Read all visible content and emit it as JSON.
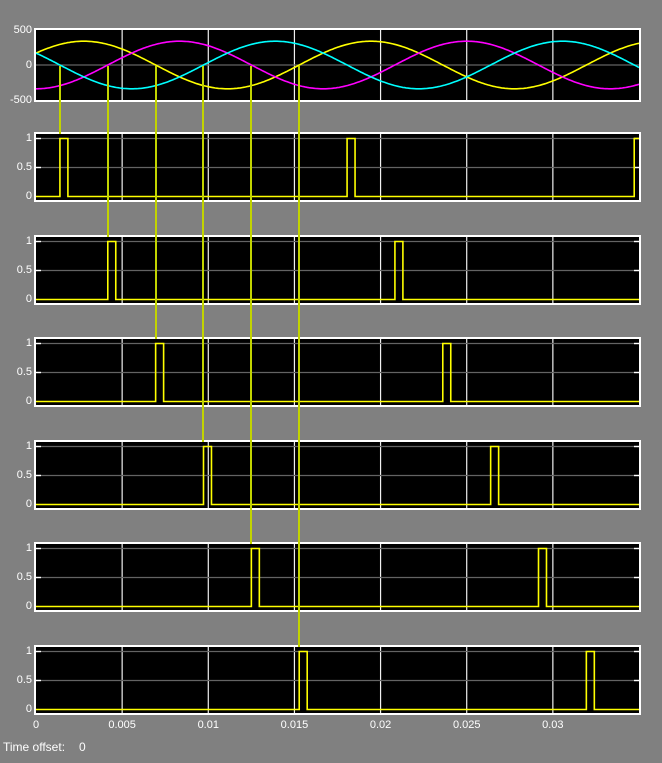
{
  "scope": {
    "time_offset_label": "Time offset:",
    "time_offset_value": "0",
    "background": "#808080",
    "plot_background": "#000000",
    "axis_box_color": "#ffffff",
    "grid_vertical_color": "#f0f0f0",
    "grid_horizontal_color": "#636363",
    "tick_text_color": "#ffffff"
  },
  "xticks": [
    {
      "label": "0",
      "t": 0
    },
    {
      "label": "0.005",
      "t": 0.005
    },
    {
      "label": "0.01",
      "t": 0.01
    },
    {
      "label": "0.015",
      "t": 0.015
    },
    {
      "label": "0.02",
      "t": 0.02
    },
    {
      "label": "0.025",
      "t": 0.025
    },
    {
      "label": "0.03",
      "t": 0.03
    }
  ],
  "connectors": {
    "color": "#c2d400",
    "times_s": [
      0.001389,
      0.004167,
      0.006944,
      0.009722,
      0.0125,
      0.015278
    ]
  },
  "chart_data": [
    {
      "type": "line",
      "name": "three-phase-voltages",
      "x_range_s": [
        0,
        0.035
      ],
      "ylim": [
        -500,
        500
      ],
      "yticks": [
        {
          "label": "500",
          "value": 500
        },
        {
          "label": "0",
          "value": 0
        },
        {
          "label": "-500",
          "value": -500
        }
      ],
      "grid_x_step_s": 0.005,
      "series": [
        {
          "name": "phase-A-voltage",
          "color": "#ffff00",
          "amplitude": 340,
          "frequency_hz": 60,
          "phase_deg": 30
        },
        {
          "name": "phase-B-voltage",
          "color": "#ff00ff",
          "amplitude": 340,
          "frequency_hz": 60,
          "phase_deg": -90
        },
        {
          "name": "phase-C-voltage",
          "color": "#00ffff",
          "amplitude": 340,
          "frequency_hz": 60,
          "phase_deg": 150
        }
      ]
    },
    {
      "type": "pulse",
      "name": "pulse-1",
      "x_range_s": [
        0,
        0.035
      ],
      "ylim": [
        -0.07,
        1.1
      ],
      "yticks": [
        {
          "label": "1",
          "value": 1
        },
        {
          "label": "0.5",
          "value": 0.5
        },
        {
          "label": "0",
          "value": 0
        }
      ],
      "grid_x_step_s": 0.005,
      "color": "#ffff00",
      "pulse_width_s": 0.000463,
      "pulse_start_times_s": [
        0.001389,
        0.018056,
        0.034722
      ]
    },
    {
      "type": "pulse",
      "name": "pulse-2",
      "x_range_s": [
        0,
        0.035
      ],
      "ylim": [
        -0.07,
        1.1
      ],
      "yticks": [
        {
          "label": "1",
          "value": 1
        },
        {
          "label": "0.5",
          "value": 0.5
        },
        {
          "label": "0",
          "value": 0
        }
      ],
      "grid_x_step_s": 0.005,
      "color": "#ffff00",
      "pulse_width_s": 0.000463,
      "pulse_start_times_s": [
        0.004167,
        0.020833
      ]
    },
    {
      "type": "pulse",
      "name": "pulse-3",
      "x_range_s": [
        0,
        0.035
      ],
      "ylim": [
        -0.07,
        1.1
      ],
      "yticks": [
        {
          "label": "1",
          "value": 1
        },
        {
          "label": "0.5",
          "value": 0.5
        },
        {
          "label": "0",
          "value": 0
        }
      ],
      "grid_x_step_s": 0.005,
      "color": "#ffff00",
      "pulse_width_s": 0.000463,
      "pulse_start_times_s": [
        0.006944,
        0.023611
      ]
    },
    {
      "type": "pulse",
      "name": "pulse-4",
      "x_range_s": [
        0,
        0.035
      ],
      "ylim": [
        -0.07,
        1.1
      ],
      "yticks": [
        {
          "label": "1",
          "value": 1
        },
        {
          "label": "0.5",
          "value": 0.5
        },
        {
          "label": "0",
          "value": 0
        }
      ],
      "grid_x_step_s": 0.005,
      "color": "#ffff00",
      "pulse_width_s": 0.000463,
      "pulse_start_times_s": [
        0.009722,
        0.026389
      ]
    },
    {
      "type": "pulse",
      "name": "pulse-5",
      "x_range_s": [
        0,
        0.035
      ],
      "ylim": [
        -0.07,
        1.1
      ],
      "yticks": [
        {
          "label": "1",
          "value": 1
        },
        {
          "label": "0.5",
          "value": 0.5
        },
        {
          "label": "0",
          "value": 0
        }
      ],
      "grid_x_step_s": 0.005,
      "color": "#ffff00",
      "pulse_width_s": 0.000463,
      "pulse_start_times_s": [
        0.0125,
        0.029167
      ]
    },
    {
      "type": "pulse",
      "name": "pulse-6",
      "x_range_s": [
        0,
        0.035
      ],
      "ylim": [
        -0.07,
        1.1
      ],
      "yticks": [
        {
          "label": "1",
          "value": 1
        },
        {
          "label": "0.5",
          "value": 0.5
        },
        {
          "label": "0",
          "value": 0
        }
      ],
      "grid_x_step_s": 0.005,
      "color": "#ffff00",
      "pulse_width_s": 0.000463,
      "pulse_start_times_s": [
        0.015278,
        0.031944
      ]
    }
  ]
}
